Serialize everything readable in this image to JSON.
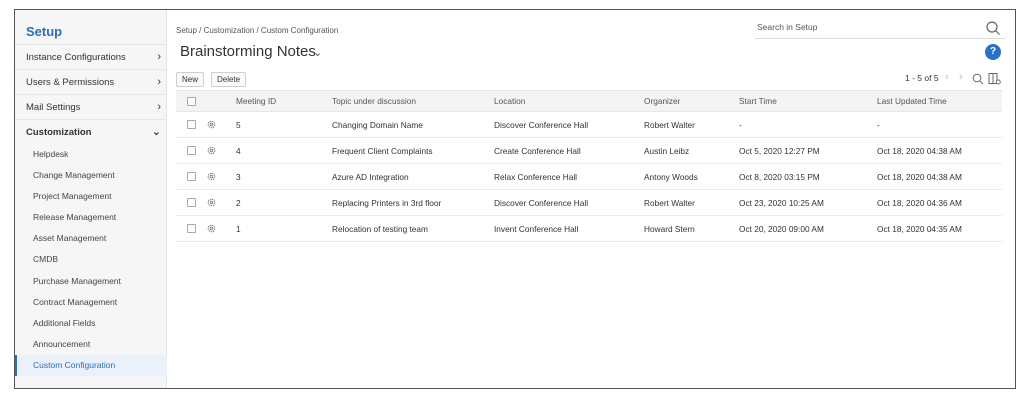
{
  "sidebar": {
    "title": "Setup",
    "items": [
      {
        "label": "Instance Configurations",
        "chevron": "›"
      },
      {
        "label": "Users & Permissions",
        "chevron": "›"
      },
      {
        "label": "Mail Settings",
        "chevron": "›"
      },
      {
        "label": "Customization",
        "chevron": "⌄"
      }
    ],
    "subitems": [
      "Helpdesk",
      "Change Management",
      "Project Management",
      "Release Management",
      "Asset Management",
      "CMDB",
      "Purchase Management",
      "Contract Management",
      "Additional Fields",
      "Announcement",
      "Custom Configuration"
    ]
  },
  "header": {
    "breadcrumb": "Setup / Customization / Custom Configuration",
    "search_placeholder": "Search in Setup",
    "page_title": "Brainstorming Notes",
    "title_caret": "⌄",
    "help": "?"
  },
  "toolbar": {
    "new_label": "New",
    "delete_label": "Delete",
    "pager_text": "1 - 5 of 5",
    "prev": "‹",
    "next": "›"
  },
  "table": {
    "columns": [
      "Meeting ID",
      "Topic under discussion",
      "Location",
      "Organizer",
      "Start Time",
      "Last Updated Time"
    ],
    "rows": [
      {
        "id": "5",
        "topic": "Changing Domain Name",
        "location": "Discover Conference Hall",
        "organizer": "Robert Walter",
        "start": "-",
        "updated": "-"
      },
      {
        "id": "4",
        "topic": "Frequent Client Complaints",
        "location": "Create Conference Hall",
        "organizer": "Austin Leibz",
        "start": "Oct 5, 2020 12:27 PM",
        "updated": "Oct 18, 2020 04:38 AM"
      },
      {
        "id": "3",
        "topic": "Azure AD Integration",
        "location": "Relax Conference Hall",
        "organizer": "Antony Woods",
        "start": "Oct 8, 2020 03:15 PM",
        "updated": "Oct 18, 2020 04:38 AM"
      },
      {
        "id": "2",
        "topic": "Replacing Printers in 3rd floor",
        "location": "Discover Conference Hall",
        "organizer": "Robert Walter",
        "start": "Oct 23, 2020 10:25 AM",
        "updated": "Oct 18, 2020 04:36 AM"
      },
      {
        "id": "1",
        "topic": "Relocation of testing team",
        "location": "Invent Conference Hall",
        "organizer": "Howard Stern",
        "start": "Oct 20, 2020 09:00 AM",
        "updated": "Oct 18, 2020 04:35 AM"
      }
    ]
  },
  "colors": {
    "accent": "#2a6fb8",
    "help_bg": "#2a72c9",
    "sidebar_bg": "#f6f6f6",
    "active_bg": "#eaf1fa"
  }
}
